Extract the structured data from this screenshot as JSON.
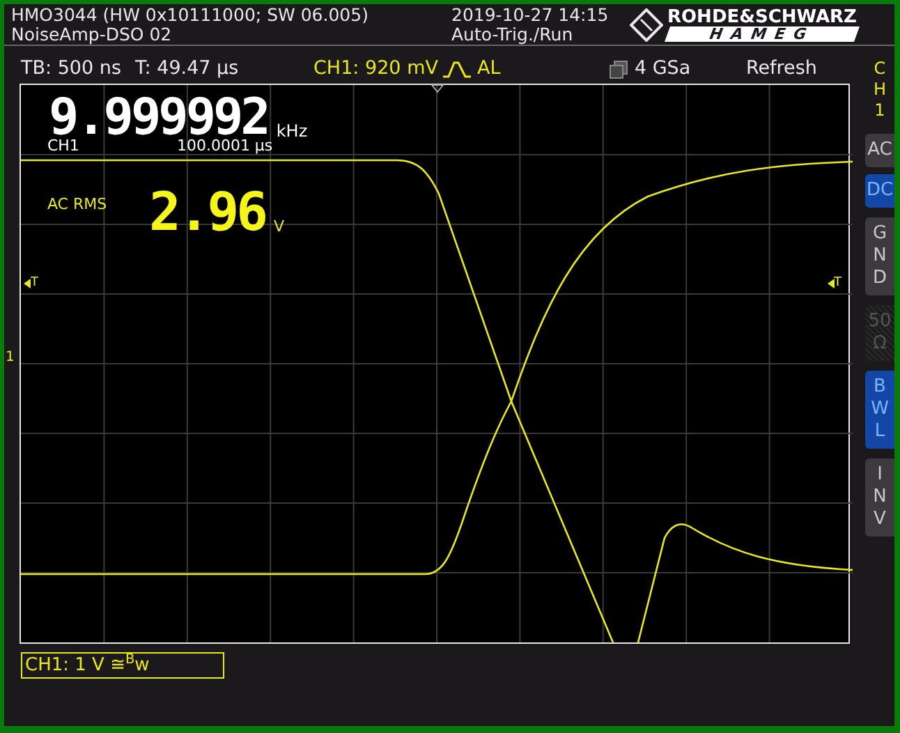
{
  "header": {
    "model": "HMO3044 (HW 0x10111000; SW 06.005)",
    "name": "NoiseAmp-DSO 02",
    "datetime": "2019-10-27 14:15",
    "trigger_mode": "Auto-Trig./Run",
    "logo_top": "ROHDE&SCHWARZ",
    "logo_bottom": "HAMEG"
  },
  "info_bar": {
    "timebase": "TB: 500 ns",
    "trigger_time": "T: 49.47 µs",
    "trigger_level": "CH1: 920 mV",
    "trigger_coupling": "AL",
    "sample_rate": "4 GSa",
    "mode": "Refresh"
  },
  "frequency": {
    "value": "9.999992",
    "unit": "kHz",
    "channel": "CH1",
    "period": "100.0001 µs"
  },
  "ac_rms": {
    "label": "AC RMS",
    "value": "2.96",
    "unit": "V"
  },
  "markers": {
    "trigger_left": "T",
    "trigger_right": "T",
    "channel": "1"
  },
  "channel_label": "CH1: 1 V ≅$^{B}$w",
  "side_panel": {
    "title": "C\nH\n1",
    "buttons": [
      {
        "label": "AC",
        "selected": false,
        "disabled": false
      },
      {
        "label": "DC",
        "selected": true,
        "disabled": false
      },
      {
        "label": "G\nN\nD",
        "selected": false,
        "disabled": false
      },
      {
        "label": "50\nΩ",
        "selected": false,
        "disabled": true
      },
      {
        "label": "B\nW\nL",
        "selected": true,
        "disabled": false
      },
      {
        "label": "I\nN\nV",
        "selected": false,
        "disabled": false
      }
    ]
  }
}
